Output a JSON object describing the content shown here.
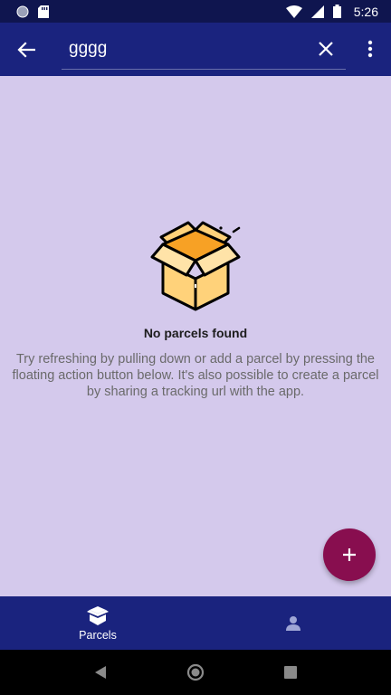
{
  "status_bar": {
    "time": "5:26",
    "icons": [
      "circle-icon",
      "sd-card-icon",
      "wifi-icon",
      "signal-icon",
      "battery-icon"
    ]
  },
  "app_bar": {
    "search_value": "gggg",
    "icons": [
      "back-arrow-icon",
      "close-icon",
      "more-vert-icon"
    ]
  },
  "empty_state": {
    "title": "No parcels found",
    "description": "Try refreshing by pulling down or add a parcel by pressing the floating action button below. It's also possible to create a parcel by sharing a tracking url with the app."
  },
  "fab": {
    "icon": "plus-icon"
  },
  "bottom_nav": {
    "items": [
      {
        "label": "Parcels",
        "icon": "parcel-box-icon",
        "selected": true
      },
      {
        "label": "",
        "icon": "person-icon",
        "selected": false
      }
    ]
  },
  "colors": {
    "primary": "#1a237e",
    "status_bar": "#0f154f",
    "background": "#d4c9ec",
    "accent": "#880e4f"
  }
}
